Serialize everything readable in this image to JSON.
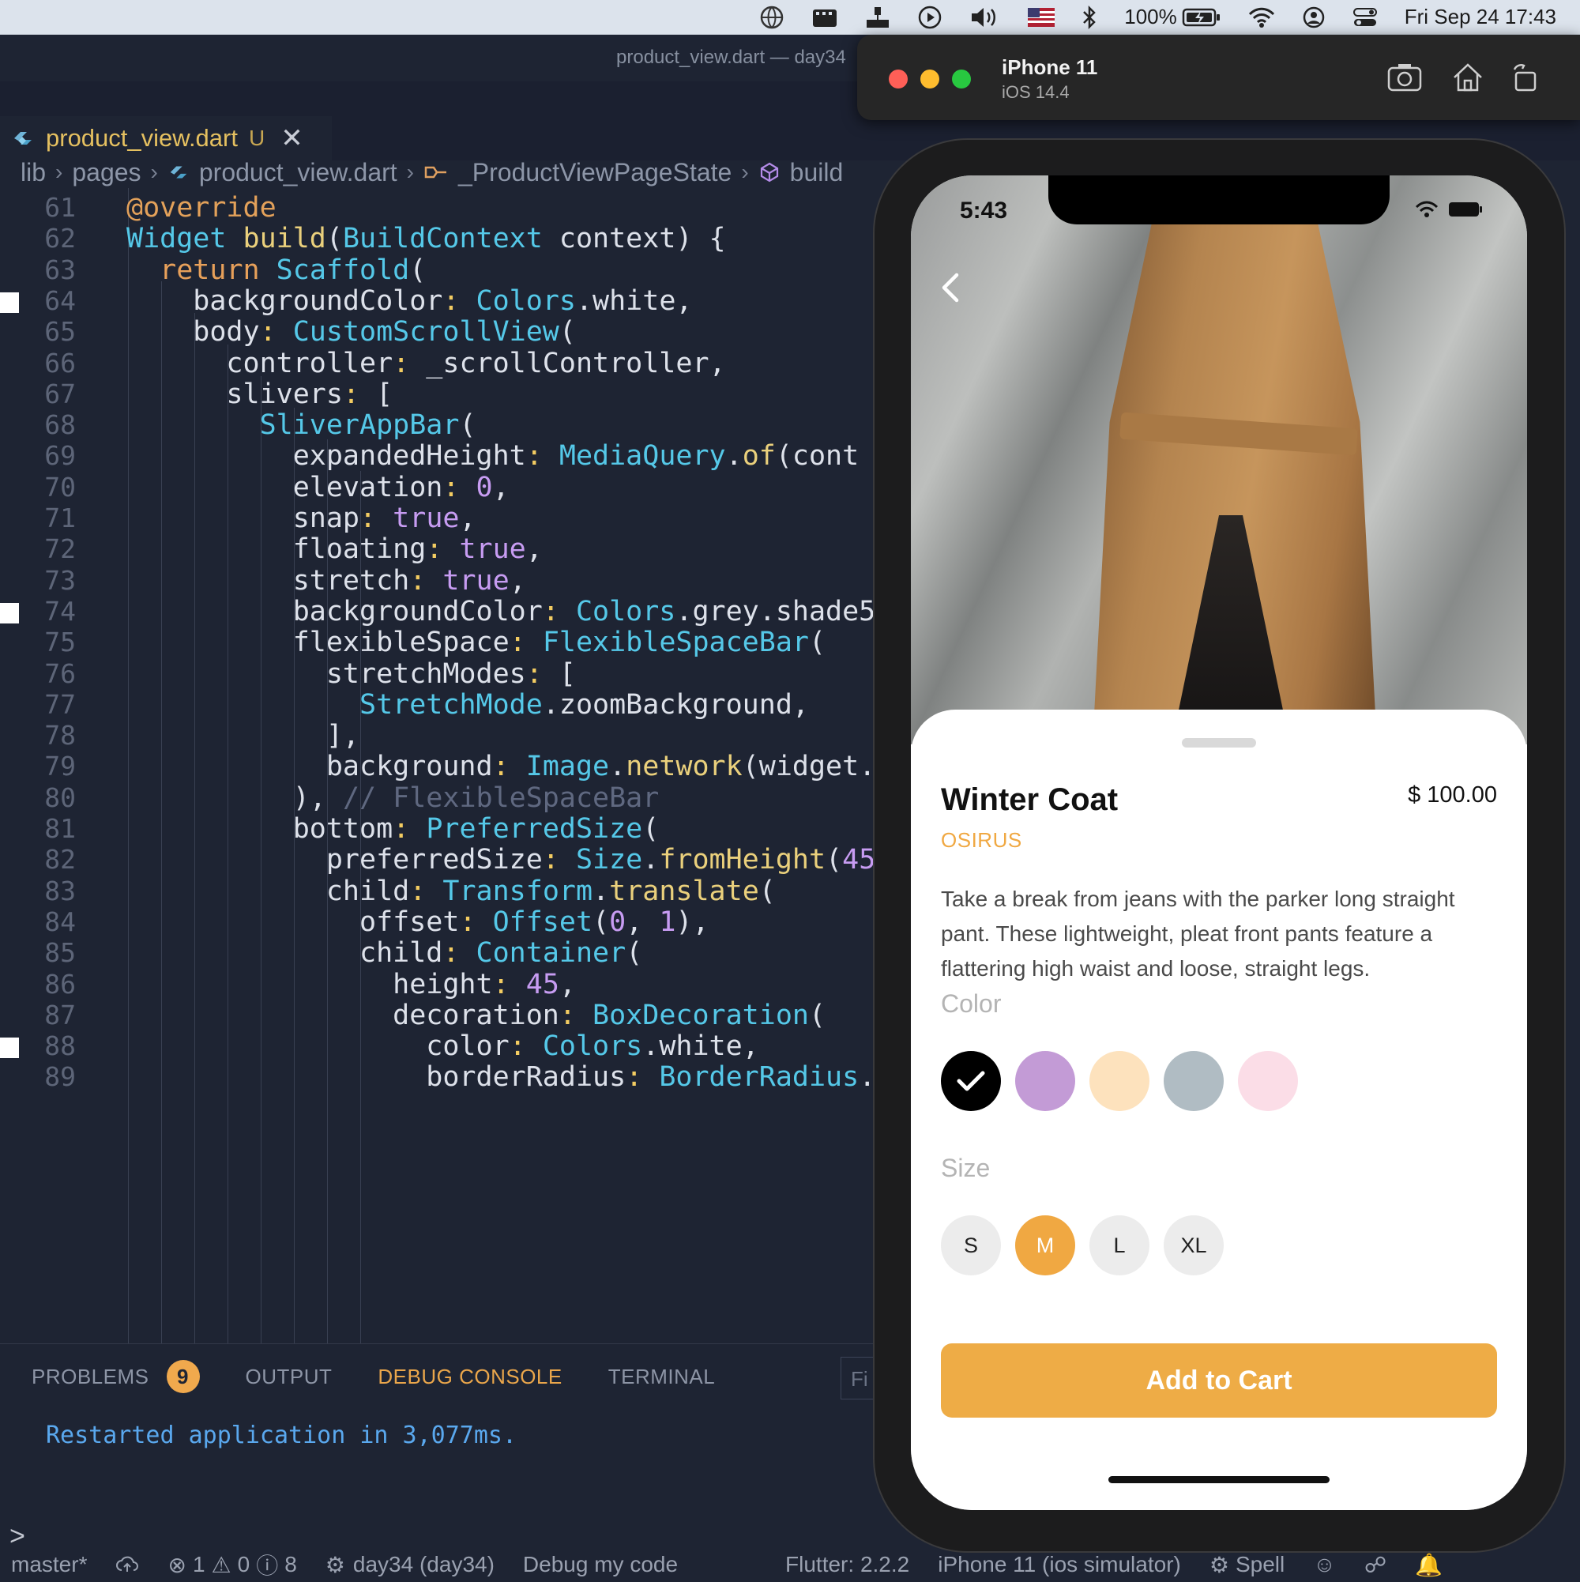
{
  "menubar": {
    "battery": "100%",
    "datetime": "Fri Sep 24  17:43"
  },
  "editor": {
    "window_title": "product_view.dart — day34",
    "tab": {
      "filename": "product_view.dart",
      "status": "U"
    },
    "breadcrumb": [
      "lib",
      "pages",
      "product_view.dart",
      "_ProductViewPageState",
      "build"
    ],
    "lines": [
      {
        "n": "61",
        "code": "@override"
      },
      {
        "n": "62",
        "code": "Widget build(BuildContext context) {"
      },
      {
        "n": "63",
        "code": "  return Scaffold("
      },
      {
        "n": "64",
        "code": "    backgroundColor: Colors.white,"
      },
      {
        "n": "65",
        "code": "    body: CustomScrollView("
      },
      {
        "n": "66",
        "code": "      controller: _scrollController,"
      },
      {
        "n": "67",
        "code": "      slivers: ["
      },
      {
        "n": "68",
        "code": "        SliverAppBar("
      },
      {
        "n": "69",
        "code": "          expandedHeight: MediaQuery.of(cont"
      },
      {
        "n": "70",
        "code": "          elevation: 0,"
      },
      {
        "n": "71",
        "code": "          snap: true,"
      },
      {
        "n": "72",
        "code": "          floating: true,"
      },
      {
        "n": "73",
        "code": "          stretch: true,"
      },
      {
        "n": "74",
        "code": "          backgroundColor: Colors.grey.shade5"
      },
      {
        "n": "75",
        "code": "          flexibleSpace: FlexibleSpaceBar("
      },
      {
        "n": "76",
        "code": "            stretchModes: ["
      },
      {
        "n": "77",
        "code": "              StretchMode.zoomBackground,"
      },
      {
        "n": "78",
        "code": "            ],"
      },
      {
        "n": "79",
        "code": "            background: Image.network(widget."
      },
      {
        "n": "80",
        "code": "          ), // FlexibleSpaceBar"
      },
      {
        "n": "81",
        "code": "          bottom: PreferredSize("
      },
      {
        "n": "82",
        "code": "            preferredSize: Size.fromHeight(45"
      },
      {
        "n": "83",
        "code": "            child: Transform.translate("
      },
      {
        "n": "84",
        "code": "              offset: Offset(0, 1),"
      },
      {
        "n": "85",
        "code": "              child: Container("
      },
      {
        "n": "86",
        "code": "                height: 45,"
      },
      {
        "n": "87",
        "code": "                decoration: BoxDecoration("
      },
      {
        "n": "88",
        "code": "                  color: Colors.white,"
      },
      {
        "n": "89",
        "code": "                  borderRadius: BorderRadius."
      }
    ]
  },
  "panel": {
    "tabs": [
      "PROBLEMS",
      "OUTPUT",
      "DEBUG CONSOLE",
      "TERMINAL"
    ],
    "problems_count": "9",
    "active_tab": "DEBUG CONSOLE",
    "filter_placeholder": "Fi",
    "console_output": "Restarted application in 3,077ms.",
    "prompt": ">"
  },
  "statusbar": {
    "branch": "master*",
    "errors": "1",
    "warnings": "0",
    "infos": "8",
    "target": "day34 (day34)",
    "debug": "Debug my code",
    "flutter": "Flutter: 2.2.2",
    "device": "iPhone 11 (ios simulator)",
    "spell": "Spell"
  },
  "simulator": {
    "device_name": "iPhone 11",
    "os": "iOS 14.4"
  },
  "app": {
    "status_time": "5:43",
    "product_name": "Winter Coat",
    "price": "$ 100.00",
    "brand": "OSIRUS",
    "description": "Take a break from jeans with the parker long straight pant. These lightweight, pleat front pants feature a flattering high waist and loose, straight legs.",
    "color_label": "Color",
    "colors": [
      "#000000",
      "#c39bd6",
      "#fde2bd",
      "#b0bcc3",
      "#fbdde7"
    ],
    "selected_color_index": 0,
    "size_label": "Size",
    "sizes": [
      "S",
      "M",
      "L",
      "XL"
    ],
    "selected_size": "M",
    "cart_button": "Add to Cart",
    "accent": "#f0a842"
  }
}
